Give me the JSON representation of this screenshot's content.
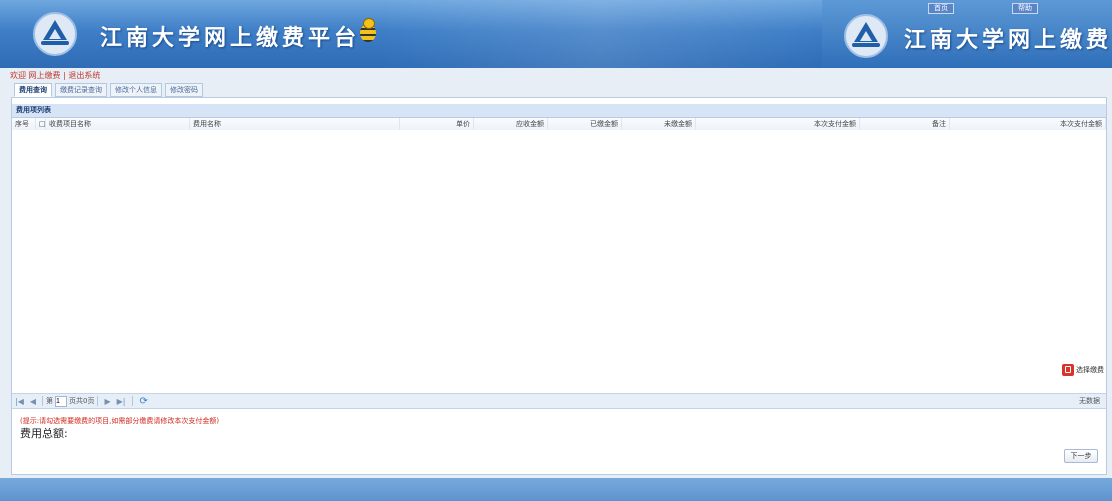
{
  "header": {
    "title": "江南大学网上缴费平台",
    "title_right": "江南大学网上缴费",
    "tag_left": "首页",
    "tag_right": "帮助"
  },
  "navline": "欢迎 网上缴费 | 退出系统",
  "tabs": [
    {
      "label": "费用查询",
      "active": true
    },
    {
      "label": "缴费记录查询",
      "active": false
    },
    {
      "label": "修改个人信息",
      "active": false
    },
    {
      "label": "修改密码",
      "active": false
    }
  ],
  "panel": {
    "title": "费用项列表",
    "columns": [
      "序号",
      "收费项目名称",
      "费用名称",
      "单价",
      "应收金额",
      "已缴金额",
      "未缴金额",
      "本次支付金额",
      "备注",
      "本次支付金额"
    ]
  },
  "float_button": {
    "label": "选择缴费"
  },
  "pager": {
    "page_label": "第",
    "page_value": "1",
    "page_of": "页共0页",
    "right_text": "无数据"
  },
  "notice": "(提示:请勾选需要缴费的项目,如需部分缴费请修改本次支付金额)",
  "total_label": "费用总额:",
  "next_button": "下一步",
  "colors": {
    "accent": "#3f7fc7",
    "warning": "#d0281e"
  }
}
